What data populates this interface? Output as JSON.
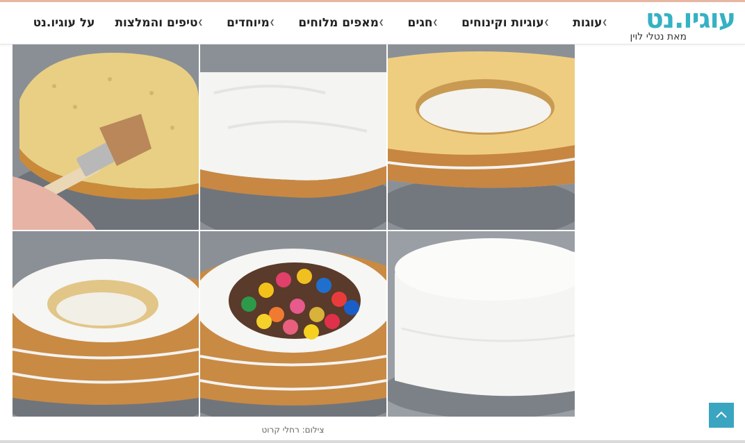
{
  "site": {
    "logo_text": "עוגיו.נט",
    "logo_tagline": "מאת נטלי לוין",
    "brand_color": "#35b1c4"
  },
  "menu": [
    {
      "label": "עוגות",
      "has_dropdown": true
    },
    {
      "label": "עוגיות וקינוחים",
      "has_dropdown": true
    },
    {
      "label": "חגים",
      "has_dropdown": true
    },
    {
      "label": "מאפים מלוחים",
      "has_dropdown": true
    },
    {
      "label": "מיוחדים",
      "has_dropdown": true
    },
    {
      "label": "טיפים והמלצות",
      "has_dropdown": true
    },
    {
      "label": "על עוגיו.נט",
      "has_dropdown": false
    }
  ],
  "gallery": {
    "photos": [
      {
        "name": "brushing-syrup-on-cake-layer"
      },
      {
        "name": "frosted-cake-layer"
      },
      {
        "name": "cake-ring-filled-with-cream"
      },
      {
        "name": "stacked-hollow-cake-layers"
      },
      {
        "name": "cake-filled-with-candies"
      },
      {
        "name": "finished-frosted-cake"
      }
    ],
    "caption": "צילום: רחלי קרוט"
  },
  "back_to_top": {
    "icon": "chevron-up-icon",
    "color": "#3aa5c0"
  }
}
